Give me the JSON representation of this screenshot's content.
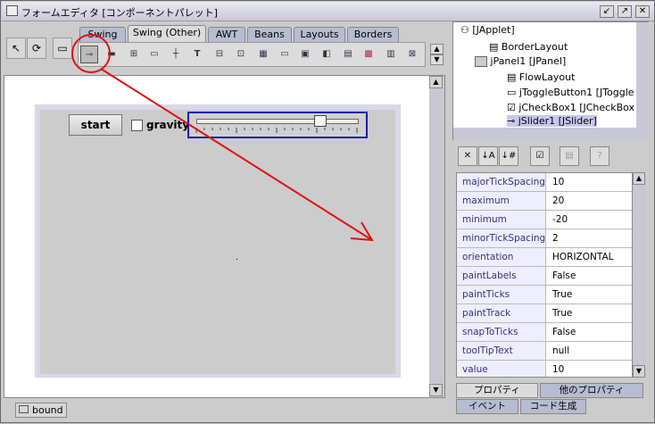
{
  "window": {
    "title": "フォームエディタ [コンポーネントパレット]"
  },
  "palette_tabs": [
    {
      "label": "Swing",
      "selected": false
    },
    {
      "label": "Swing (Other)",
      "selected": true
    },
    {
      "label": "AWT",
      "selected": false
    },
    {
      "label": "Beans",
      "selected": false
    },
    {
      "label": "Layouts",
      "selected": false
    },
    {
      "label": "Borders",
      "selected": false
    }
  ],
  "form": {
    "start_button": "start",
    "checkbox_label": "gravity"
  },
  "status": {
    "tab_label": "bound"
  },
  "tree": {
    "nodes": [
      {
        "label": "[JApplet]"
      },
      {
        "label": "BorderLayout"
      },
      {
        "label": "jPanel1 [JPanel]"
      },
      {
        "label": "FlowLayout"
      },
      {
        "label": "jToggleButton1 [JToggle"
      },
      {
        "label": "jCheckBox1 [JCheckBox"
      },
      {
        "label": "jSlider1 [JSlider]"
      }
    ]
  },
  "properties": [
    {
      "name": "majorTickSpacing",
      "value": "10"
    },
    {
      "name": "maximum",
      "value": "20"
    },
    {
      "name": "minimum",
      "value": "-20"
    },
    {
      "name": "minorTickSpacing",
      "value": "2"
    },
    {
      "name": "orientation",
      "value": "HORIZONTAL"
    },
    {
      "name": "paintLabels",
      "value": "False"
    },
    {
      "name": "paintTicks",
      "value": "True"
    },
    {
      "name": "paintTrack",
      "value": "True"
    },
    {
      "name": "snapToTicks",
      "value": "False"
    },
    {
      "name": "toolTipText",
      "value": "null"
    },
    {
      "name": "value",
      "value": "10"
    }
  ],
  "property_tabs": [
    {
      "label": "プロパティ",
      "selected": true
    },
    {
      "label": "他のプロパティ",
      "selected": false
    },
    {
      "label": "イベント",
      "selected": false
    },
    {
      "label": "コード生成",
      "selected": false
    }
  ],
  "colors": {
    "annotation": "#e01010",
    "selection": "#1a1aa8"
  }
}
